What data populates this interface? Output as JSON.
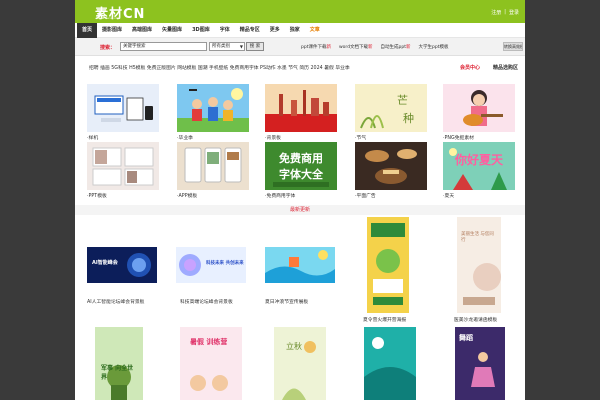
{
  "header": {
    "logo": "素材CN",
    "logo_sub": "www.sucai.com",
    "links": [
      "注册",
      "|",
      "登录"
    ]
  },
  "nav": {
    "items": [
      {
        "label": "首页",
        "style": "active"
      },
      {
        "label": "摄影图库",
        "style": ""
      },
      {
        "label": "高端图库",
        "style": ""
      },
      {
        "label": "矢量图库",
        "style": ""
      },
      {
        "label": "3D图库",
        "style": ""
      },
      {
        "label": "字体",
        "style": ""
      },
      {
        "label": "精品专区",
        "style": ""
      },
      {
        "label": "更多",
        "style": ""
      },
      {
        "label": "独家",
        "style": ""
      },
      {
        "label": "文章",
        "style": "orange"
      }
    ]
  },
  "search": {
    "label": "搜索：",
    "value": "关键字搜索",
    "category": "所有类别",
    "button": "搜 索",
    "quicklinks": [
      {
        "label": "ppt课件下载",
        "badge": "新"
      },
      {
        "label": "word文档下载",
        "badge": "新"
      },
      {
        "label": "自动生成ppt",
        "badge": "新"
      },
      {
        "label": "大学生ppt模板",
        "badge": ""
      }
    ],
    "convert": "转换高效模式"
  },
  "tags": {
    "text": "招聘  插画  5G科技  H5模板  免费正版图片  网站模板  国潮  手机壁纸  免费商用字体  PS动作  水墨  节气  简历  2024  暑假  毕业季",
    "member": "会员中心",
    "boutique": "精品选购区"
  },
  "categories": [
    {
      "label": "·样机",
      "icon": "mockup-image"
    },
    {
      "label": "·毕业季",
      "icon": "graduation-image"
    },
    {
      "label": "·背景板",
      "icon": "skyline-image"
    },
    {
      "label": "·节气",
      "icon": "solar-term-image"
    },
    {
      "label": "·PNG免抠素材",
      "icon": "guitar-girl-image"
    },
    {
      "label": "·PPT模板",
      "icon": "ppt-image"
    },
    {
      "label": "·APP模板",
      "icon": "app-image"
    },
    {
      "label": "·免费商用字体",
      "icon": "font-image"
    },
    {
      "label": "·平面广告",
      "icon": "food-ad-image"
    },
    {
      "label": "·夏天",
      "icon": "summer-image"
    }
  ],
  "latest": {
    "title": "最新更新",
    "row1": [
      {
        "label": "AI人工智能论坛峰会背景板",
        "banner": "AI智能峰会"
      },
      {
        "label": "科技高端论坛峰会背景板",
        "banner": "科技未来 共创未来"
      },
      {
        "label": "夏日冲浪节宣传展板",
        "banner": ""
      },
      {
        "label": "夏令营火爆开营海报",
        "banner": ""
      },
      {
        "label": "医美沙龙邀请函模板",
        "banner": "美丽生活 与您同行"
      }
    ],
    "row2": [
      {
        "label": "",
        "banner": "军事 向全世界"
      },
      {
        "label": "",
        "banner": "暑假 训练营"
      },
      {
        "label": "",
        "banner": "立秋"
      },
      {
        "label": "",
        "banner": ""
      },
      {
        "label": "",
        "banner": "舞蹈"
      }
    ]
  }
}
